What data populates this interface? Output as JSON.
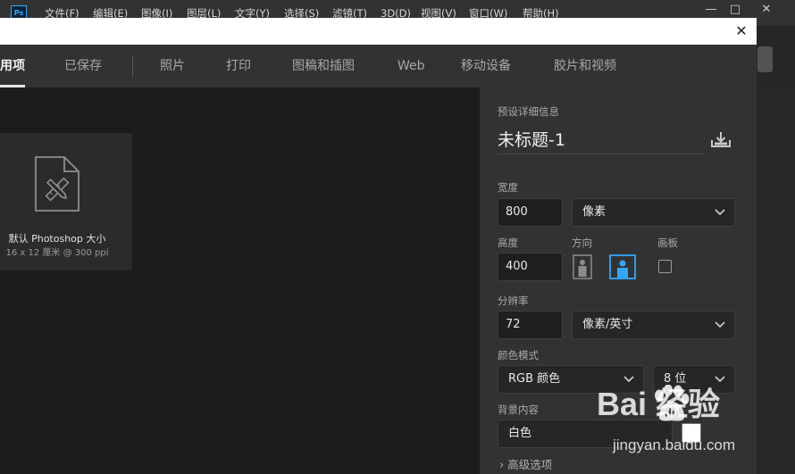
{
  "app": {
    "logo_text": "Ps"
  },
  "menubar": {
    "items": [
      "文件(F)",
      "编辑(E)",
      "图像(I)",
      "图层(L)",
      "文字(Y)",
      "选择(S)",
      "滤镜(T)",
      "3D(D)",
      "视图(V)",
      "窗口(W)",
      "帮助(H)"
    ]
  },
  "window_controls": {
    "minimize": "—",
    "maximize": "□",
    "close": "✕"
  },
  "dialog": {
    "close": "✕",
    "tabs": [
      "用项",
      "已保存",
      "照片",
      "打印",
      "图稿和插图",
      "Web",
      "移动设备",
      "胶片和视频"
    ],
    "active_tab_index": 0
  },
  "preset": {
    "name": "默认 Photoshop 大小",
    "size": "16 x 12 厘米 @ 300 ppi"
  },
  "details": {
    "header": "预设详细信息",
    "doc_name": "未标题-1",
    "width_label": "宽度",
    "width_value": "800",
    "width_unit": "像素",
    "height_label": "高度",
    "height_value": "400",
    "orientation_label": "方向",
    "artboard_label": "画板",
    "artboard_checked": false,
    "resolution_label": "分辨率",
    "resolution_value": "72",
    "resolution_unit": "像素/英寸",
    "color_mode_label": "颜色模式",
    "color_mode_value": "RGB 颜色",
    "bit_depth_value": "8 位",
    "bg_label": "背景内容",
    "bg_value": "白色",
    "advanced_label": "高级选项"
  },
  "watermark": {
    "main": "Bai  经验",
    "sub": "jingyan.baidu.com"
  },
  "colors": {
    "accent": "#31a8ff",
    "panel": "#323232",
    "dialog_bg": "#1c1c1c"
  }
}
